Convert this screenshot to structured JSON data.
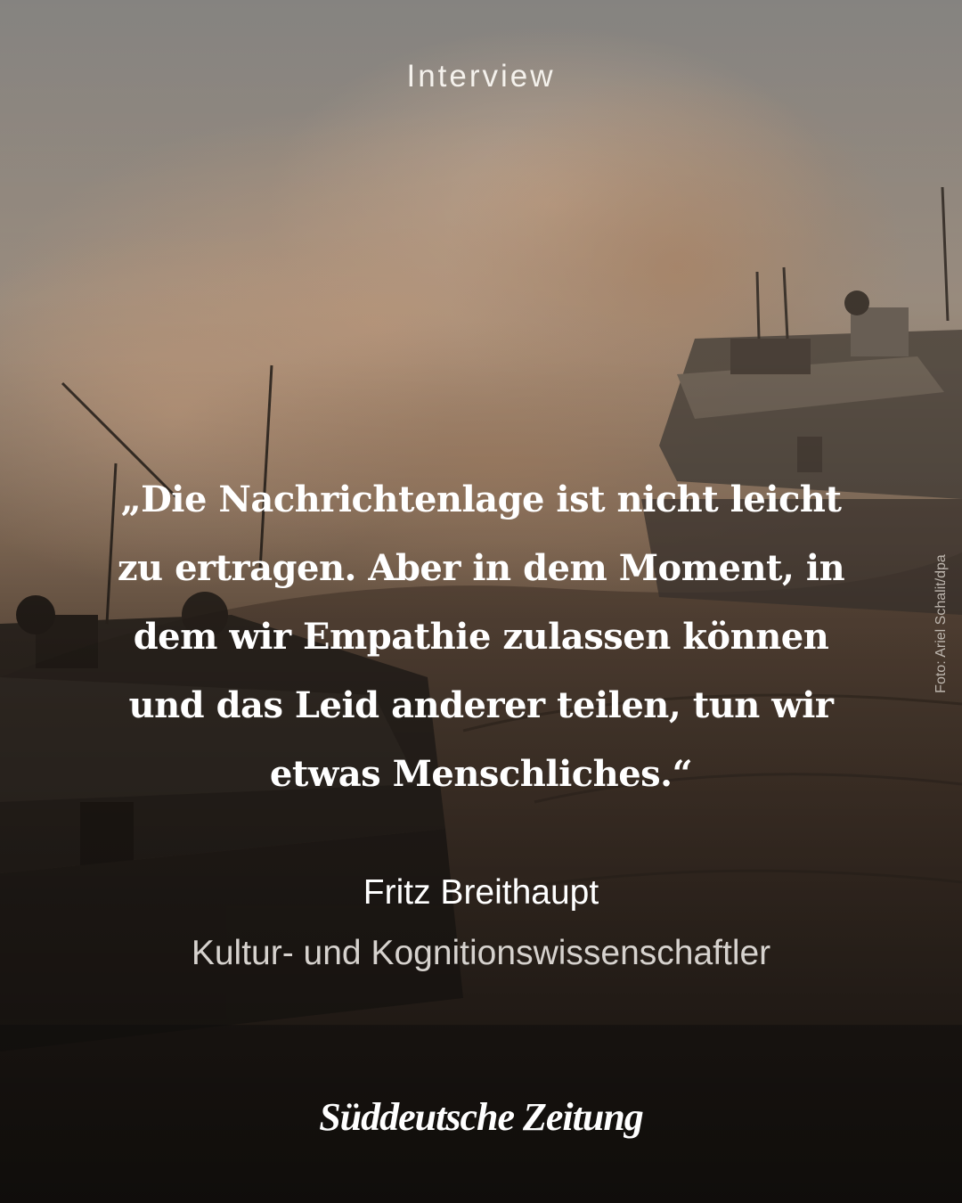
{
  "header": {
    "kicker": "Interview"
  },
  "quote": {
    "lines": [
      "„Die Nachrichtenlage ist nicht leicht",
      "zu ertragen. Aber in dem Moment, in",
      "dem wir Empathie zulassen können",
      "und das Leid anderer teilen, tun wir",
      "etwas Menschliches.“"
    ]
  },
  "author": {
    "name": "Fritz Breithaupt",
    "role": "Kultur- und Kognitionswissenschaftler"
  },
  "photo": {
    "credit": "Foto: Ariel Schalit/dpa",
    "description_icon": "tanks-in-dust-photo"
  },
  "brand": {
    "logo_text": "Süddeutsche Zeitung"
  },
  "colors": {
    "text": "#ffffff",
    "subtext": "#d6d2ce",
    "credit": "#bdb6ae"
  }
}
